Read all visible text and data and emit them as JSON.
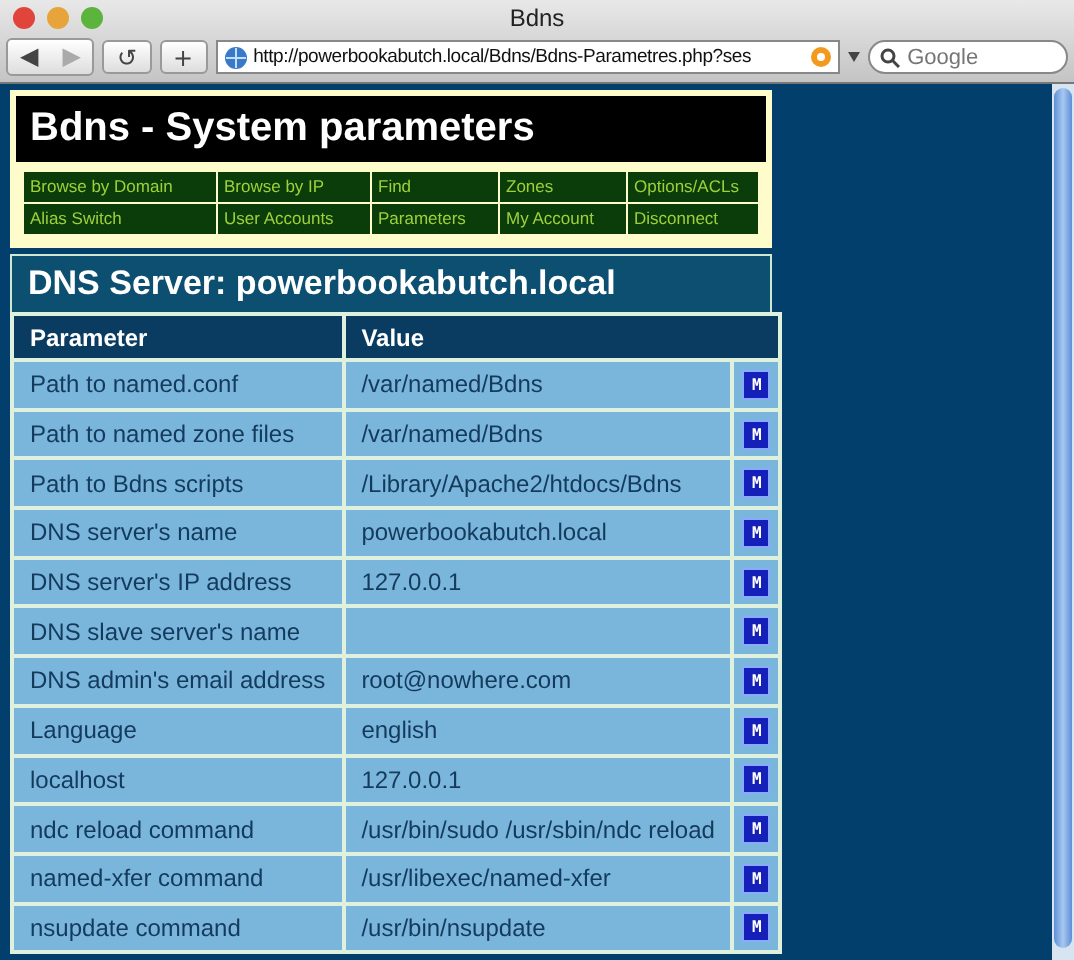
{
  "window": {
    "title": "Bdns"
  },
  "toolbar": {
    "buttons": [
      {
        "kind": "back",
        "label": "◀",
        "disabled": false
      },
      {
        "kind": "forward",
        "label": "▶",
        "disabled": true
      },
      {
        "kind": "reload",
        "label": "↺",
        "disabled": false
      },
      {
        "kind": "add",
        "label": "+",
        "disabled": false
      }
    ],
    "address": "http://powerbookabutch.local/Bdns/Bdns-Parametres.php?ses",
    "search": {
      "placeholder": "Google"
    }
  },
  "page": {
    "title": "Bdns - System parameters",
    "nav": [
      [
        "Browse by Domain",
        "Browse by IP",
        "Find",
        "Zones",
        "Options/ACLs"
      ],
      [
        "Alias Switch",
        "User Accounts",
        "Parameters",
        "My Account",
        "Disconnect"
      ]
    ],
    "server_heading": "DNS Server: powerbookabutch.local",
    "table": {
      "columns": [
        "Parameter",
        "Value"
      ],
      "rows": [
        {
          "parameter": "Path to named.conf",
          "value": "/var/named/Bdns",
          "action": "M"
        },
        {
          "parameter": "Path to named zone files",
          "value": "/var/named/Bdns",
          "action": "M"
        },
        {
          "parameter": "Path to Bdns scripts",
          "value": "/Library/Apache2/htdocs/Bdns",
          "action": "M"
        },
        {
          "parameter": "DNS server's name",
          "value": "powerbookabutch.local",
          "action": "M"
        },
        {
          "parameter": "DNS server's IP address",
          "value": "127.0.0.1",
          "action": "M"
        },
        {
          "parameter": "DNS slave server's name",
          "action": "M"
        },
        {
          "parameter": "DNS admin's email address",
          "value": "root@nowhere.com",
          "action": "M"
        },
        {
          "parameter": "Language",
          "value": "english",
          "action": "M"
        },
        {
          "parameter": "localhost",
          "value": "127.0.0.1",
          "action": "M"
        },
        {
          "parameter": "ndc reload command",
          "value": "/usr/bin/sudo /usr/sbin/ndc reload",
          "action": "M"
        },
        {
          "parameter": "named-xfer command",
          "value": "/usr/libexec/named-xfer",
          "action": "M"
        },
        {
          "parameter": "nsupdate command",
          "value": "/usr/bin/nsupdate",
          "action": "M"
        }
      ]
    }
  }
}
